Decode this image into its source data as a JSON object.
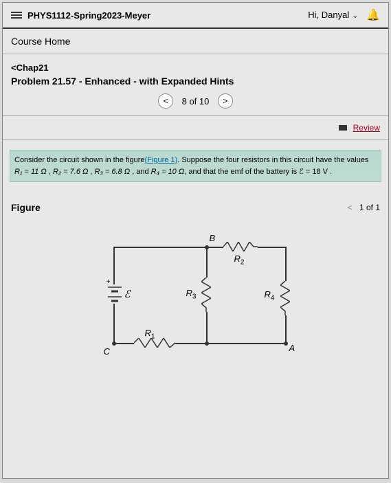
{
  "header": {
    "course": "PHYS1112-Spring2023-Meyer",
    "greeting": "Hi, Danyal"
  },
  "nav": {
    "course_home": "Course Home",
    "breadcrumb": "<Chap21",
    "problem_title": "Problem 21.57 - Enhanced - with Expanded Hints",
    "counter": "8 of 10",
    "review": "Review"
  },
  "problem": {
    "text_pre": "Consider the circuit shown in the figure",
    "fig_link": "(Figure 1)",
    "text_mid": ". Suppose the four resistors in this circuit have the values ",
    "r1": "R₁ = 11 Ω",
    "r2": "R₂ = 7.6 Ω",
    "r3": "R₃ = 6.8 Ω",
    "r4": "R₄ = 10 Ω",
    "emf_text": ", and that the emf of the battery is ℰ = 18 V ."
  },
  "figure": {
    "label": "Figure",
    "count": "1 of 1",
    "nodes": {
      "A": "A",
      "B": "B",
      "C": "C"
    },
    "components": {
      "R1": "R",
      "R2": "R",
      "R3": "R",
      "R4": "R",
      "emf": "ℰ"
    },
    "subs": {
      "s1": "1",
      "s2": "2",
      "s3": "3",
      "s4": "4"
    }
  }
}
